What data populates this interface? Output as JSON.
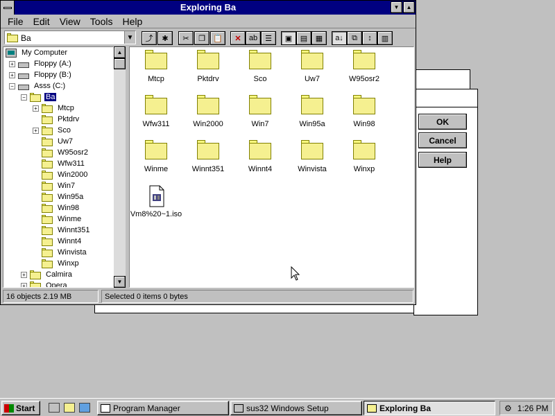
{
  "window": {
    "title": "Exploring Ba",
    "menu": [
      "File",
      "Edit",
      "View",
      "Tools",
      "Help"
    ],
    "address": "Ba"
  },
  "tree": [
    {
      "label": "My Computer",
      "icon": "computer-icon",
      "level": 0,
      "expander": "none"
    },
    {
      "label": "Floppy (A:)",
      "icon": "floppy-drive-icon",
      "level": 1,
      "expander": "plus"
    },
    {
      "label": "Floppy (B:)",
      "icon": "floppy-drive-icon",
      "level": 1,
      "expander": "plus"
    },
    {
      "label": "Asss (C:)",
      "icon": "hard-drive-icon",
      "level": 1,
      "expander": "minus"
    },
    {
      "label": "Ba",
      "icon": "open-folder-icon",
      "level": 2,
      "expander": "minus",
      "selected": true
    },
    {
      "label": "Mtcp",
      "icon": "folder-icon",
      "level": 3,
      "expander": "plus"
    },
    {
      "label": "Pktdrv",
      "icon": "folder-icon",
      "level": 3,
      "expander": "none"
    },
    {
      "label": "Sco",
      "icon": "folder-icon",
      "level": 3,
      "expander": "plus"
    },
    {
      "label": "Uw7",
      "icon": "folder-icon",
      "level": 3,
      "expander": "none"
    },
    {
      "label": "W95osr2",
      "icon": "folder-icon",
      "level": 3,
      "expander": "none"
    },
    {
      "label": "Wfw311",
      "icon": "folder-icon",
      "level": 3,
      "expander": "none"
    },
    {
      "label": "Win2000",
      "icon": "folder-icon",
      "level": 3,
      "expander": "none"
    },
    {
      "label": "Win7",
      "icon": "folder-icon",
      "level": 3,
      "expander": "none"
    },
    {
      "label": "Win95a",
      "icon": "folder-icon",
      "level": 3,
      "expander": "none"
    },
    {
      "label": "Win98",
      "icon": "folder-icon",
      "level": 3,
      "expander": "none"
    },
    {
      "label": "Winme",
      "icon": "folder-icon",
      "level": 3,
      "expander": "none"
    },
    {
      "label": "Winnt351",
      "icon": "folder-icon",
      "level": 3,
      "expander": "none"
    },
    {
      "label": "Winnt4",
      "icon": "folder-icon",
      "level": 3,
      "expander": "none"
    },
    {
      "label": "Winvista",
      "icon": "folder-icon",
      "level": 3,
      "expander": "none"
    },
    {
      "label": "Winxp",
      "icon": "folder-icon",
      "level": 3,
      "expander": "none"
    },
    {
      "label": "Calmira",
      "icon": "folder-icon",
      "level": 2,
      "expander": "plus"
    },
    {
      "label": "Opera",
      "icon": "folder-icon",
      "level": 2,
      "expander": "plus"
    }
  ],
  "items": [
    {
      "label": "Mtcp",
      "type": "folder"
    },
    {
      "label": "Pktdrv",
      "type": "folder"
    },
    {
      "label": "Sco",
      "type": "folder"
    },
    {
      "label": "Uw7",
      "type": "folder"
    },
    {
      "label": "W95osr2",
      "type": "folder"
    },
    {
      "label": "Wfw311",
      "type": "folder"
    },
    {
      "label": "Win2000",
      "type": "folder"
    },
    {
      "label": "Win7",
      "type": "folder"
    },
    {
      "label": "Win95a",
      "type": "folder"
    },
    {
      "label": "Win98",
      "type": "folder"
    },
    {
      "label": "Winme",
      "type": "folder"
    },
    {
      "label": "Winnt351",
      "type": "folder"
    },
    {
      "label": "Winnt4",
      "type": "folder"
    },
    {
      "label": "Winvista",
      "type": "folder"
    },
    {
      "label": "Winxp",
      "type": "folder"
    },
    {
      "label": "Vm8%20~1.iso",
      "type": "file"
    }
  ],
  "status": {
    "objects": "16 objects  2.19 MB",
    "selected": "Selected 0 items  0 bytes"
  },
  "setup_dialog": {
    "ok": "OK",
    "cancel": "Cancel",
    "help": "Help"
  },
  "taskbar": {
    "start": "Start",
    "tasks": [
      {
        "label": "Program Manager",
        "active": false
      },
      {
        "label": "sus32 Windows Setup",
        "active": false
      },
      {
        "label": "Exploring Ba",
        "active": true
      }
    ],
    "clock": "1:26 PM"
  }
}
